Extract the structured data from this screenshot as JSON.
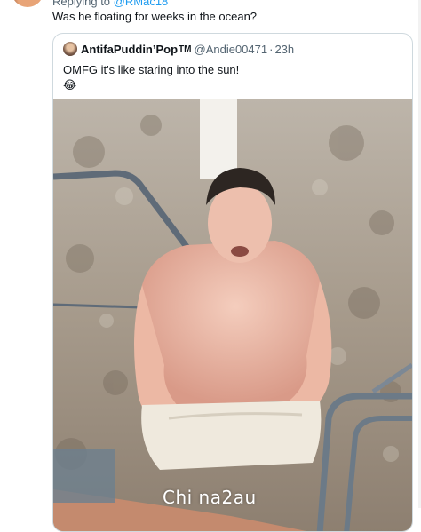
{
  "reply": {
    "replying_prefix": "Replying to",
    "replying_handle": "@RMac18",
    "text": "Was he floating for weeks in the ocean?"
  },
  "quote": {
    "display_name": "AntifaPuddin’Pop",
    "tm": "TM",
    "handle": "@Andie00471",
    "separator": "·",
    "time": "23h",
    "text": "OMFG it's like staring into the sun!",
    "emoji": "😂",
    "image": {
      "watermark": "Chi na2au"
    }
  },
  "colors": {
    "link": "#1d9bf0",
    "secondary_text": "#536471",
    "border": "#cfd9de"
  }
}
